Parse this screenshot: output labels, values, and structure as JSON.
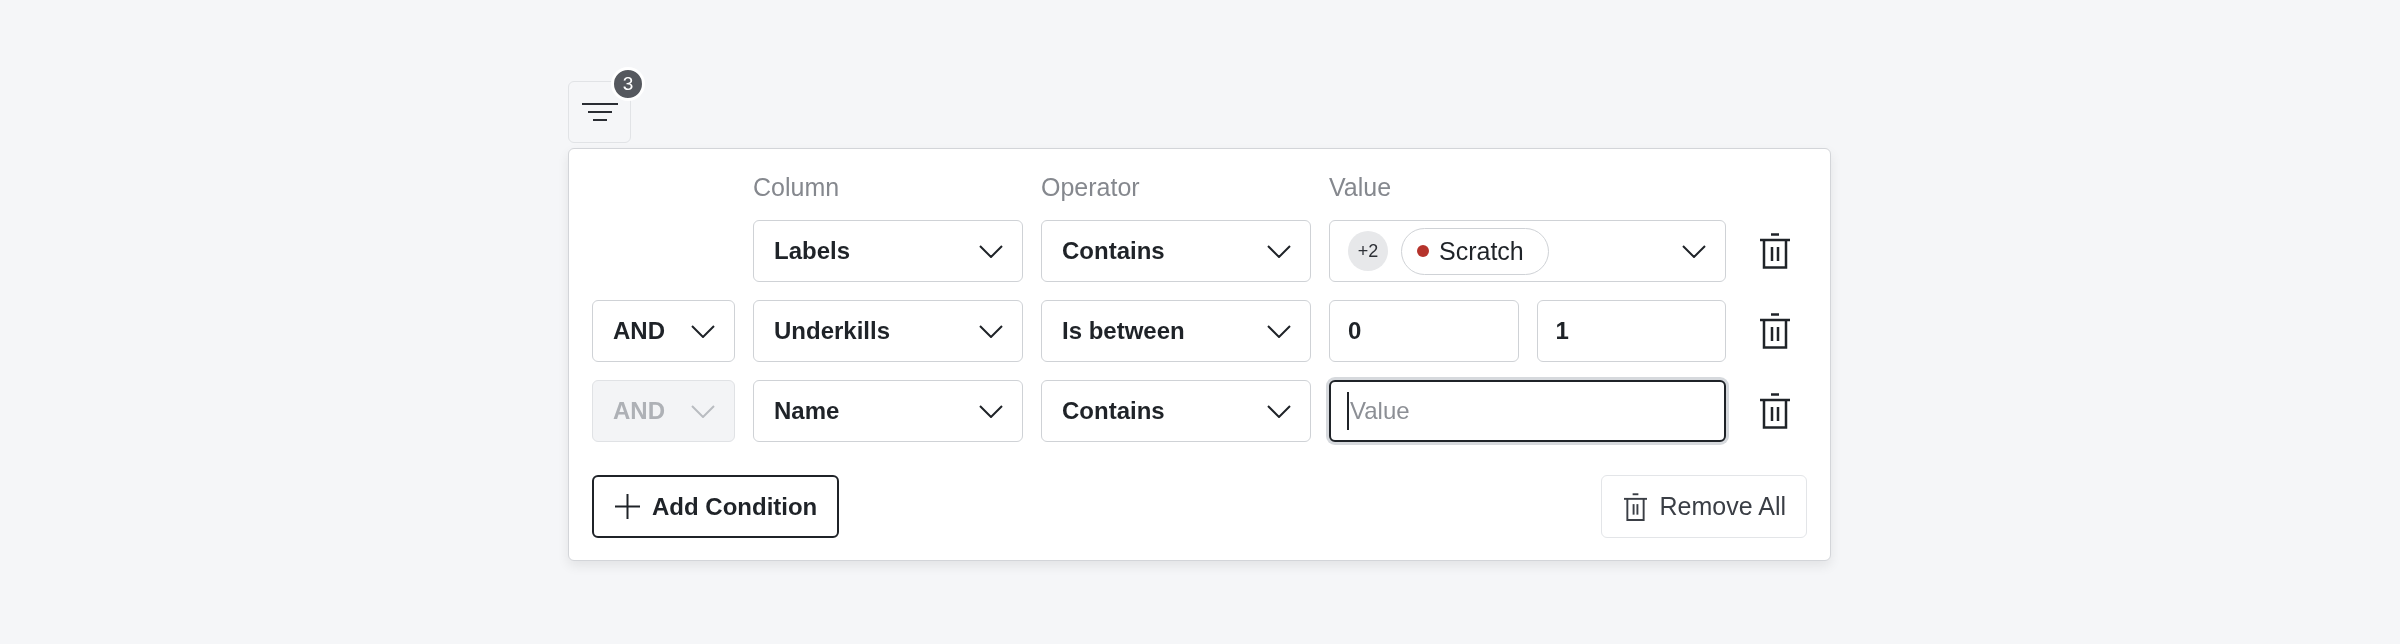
{
  "filter_button": {
    "badge": "3"
  },
  "headers": [
    "Column",
    "Operator",
    "Value"
  ],
  "conditions": [
    {
      "column": "Labels",
      "operator": "Contains",
      "value": {
        "kind": "tags",
        "more": "+2",
        "tags": [
          {
            "label": "Scratch",
            "color": "#b5332b"
          }
        ]
      }
    },
    {
      "conjunction": {
        "label": "AND",
        "disabled": false
      },
      "column": "Underkills",
      "operator": "Is between",
      "value": {
        "kind": "inputs",
        "fields": [
          {
            "value": "0",
            "focused": false
          },
          {
            "value": "1",
            "focused": false
          }
        ]
      }
    },
    {
      "conjunction": {
        "label": "AND",
        "disabled": true
      },
      "column": "Name",
      "operator": "Contains",
      "value": {
        "kind": "inputs",
        "fields": [
          {
            "placeholder": "Value",
            "focused": true
          }
        ]
      }
    }
  ],
  "add_button": {
    "label": "Add Condition"
  },
  "remove_all_button": {
    "label": "Remove All"
  }
}
